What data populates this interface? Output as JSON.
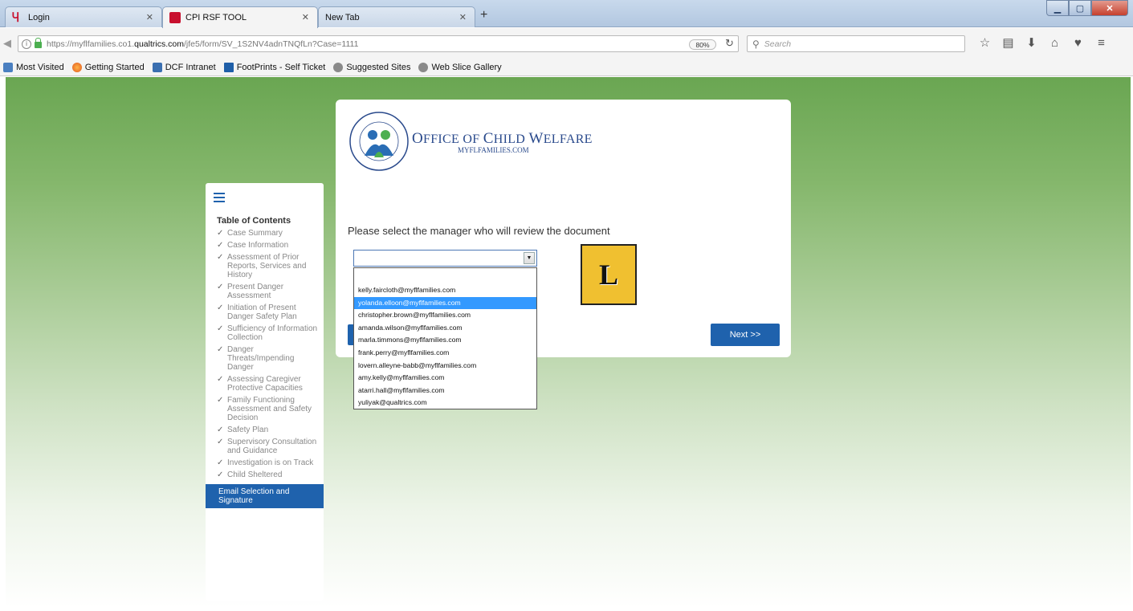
{
  "tabs": [
    {
      "title": "Login",
      "favicon": "qualtrics-q-icon"
    },
    {
      "title": "CPI RSF TOOL",
      "favicon": "qualtrics-box-icon",
      "active": true
    },
    {
      "title": "New Tab",
      "favicon": ""
    }
  ],
  "address": {
    "prefix": "https://myflfamilies.co1.",
    "domain": "qualtrics.com",
    "path": "/jfe5/form/SV_1S2NV4adnTNQfLn?Case=1111",
    "zoom": "80%"
  },
  "search": {
    "placeholder": "Search"
  },
  "bookmarks": [
    {
      "label": "Most Visited"
    },
    {
      "label": "Getting Started"
    },
    {
      "label": "DCF Intranet"
    },
    {
      "label": "FootPrints - Self Ticket"
    },
    {
      "label": "Suggested Sites"
    },
    {
      "label": "Web Slice Gallery"
    }
  ],
  "header": {
    "org_title_first": "O",
    "org_title_rest1": "FFICE OF ",
    "org_title_c": "C",
    "org_title_rest2": "HILD ",
    "org_title_w": "W",
    "org_title_rest3": "ELFARE",
    "org_sub": "MYFLFAMILIES.COM"
  },
  "question": {
    "text": "Please select the manager who will review the document",
    "selected_value": "",
    "options": [
      "kelly.faircloth@myflfamilies.com",
      "yolanda.elloon@myflfamilies.com",
      "christopher.brown@myflfamilies.com",
      "amanda.wilson@myflfamilies.com",
      "marla.timmons@myflfamilies.com",
      "frank.perry@myflfamilies.com",
      "lovern.alleyne-babb@myflfamilies.com",
      "amy.kelly@myflfamilies.com",
      "atarri.hall@myflfamilies.com",
      "yuliyak@qualtrics.com"
    ],
    "highlighted_index": 1
  },
  "buttons": {
    "next": "Next >>"
  },
  "badge": {
    "letter": "L",
    "color": "#f0c030"
  },
  "toc": {
    "title": "Table of Contents",
    "items": [
      "Case Summary",
      "Case Information",
      "Assessment of Prior Reports, Services and History",
      "Present Danger Assessment",
      "Initiation of Present Danger Safety Plan",
      "Sufficiency of Information Collection",
      "Danger Threats/Impending Danger",
      "Assessing Caregiver Protective Capacities",
      "Family Functioning Assessment and Safety Decision",
      "Safety Plan",
      "Supervisory Consultation and Guidance",
      "Investigation is on Track",
      "Child Sheltered"
    ],
    "active_item": "Email Selection and Signature"
  },
  "colors": {
    "accent": "#1f62ad",
    "highlight": "#3399ff",
    "org_blue": "#2a4a8c"
  }
}
